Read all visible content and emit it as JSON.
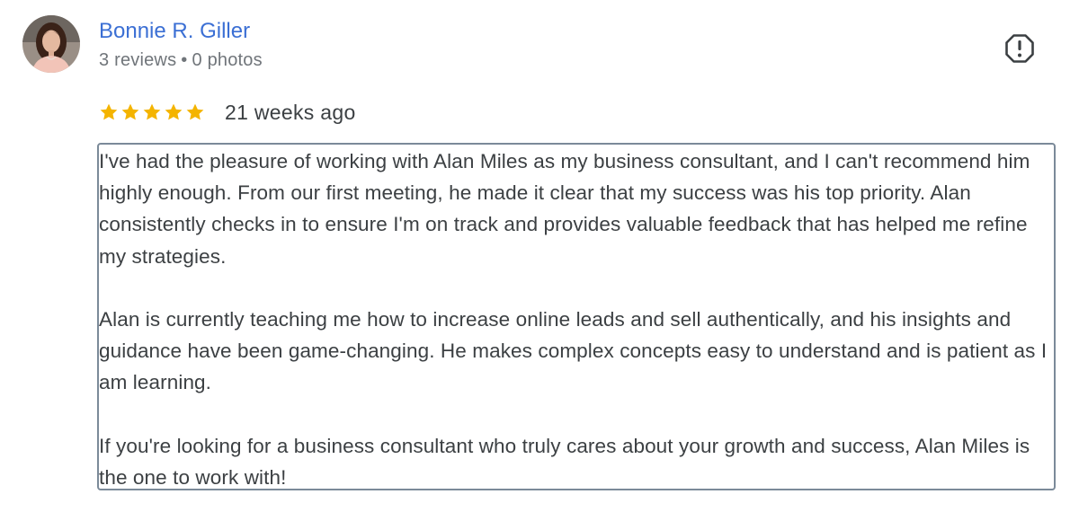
{
  "author": {
    "name": "Bonnie R. Giller",
    "reviews": "3 reviews",
    "separator": "•",
    "photos": "0 photos",
    "avatar_icon": "profile-photo"
  },
  "rating": {
    "stars": 5,
    "max_stars": 5,
    "time_ago": "21 weeks ago",
    "star_color": "#f4b400"
  },
  "actions": {
    "flag_icon": "report-flag-icon"
  },
  "review": {
    "paragraphs": [
      "I've had the pleasure of working with Alan Miles as my business consultant, and I can't recommend him highly enough. From our first meeting, he made it clear that my success was his top priority. Alan consistently checks in to ensure I'm on track and provides valuable feedback that has helped me refine my strategies.",
      "Alan is currently teaching me how to increase online leads and sell authentically, and his insights and guidance have been game-changing. He makes complex concepts easy to understand and is patient as I am learning.",
      "If you're looking for a business consultant who truly cares about your growth and success, Alan Miles is the one to work with!"
    ]
  },
  "colors": {
    "name_link": "#3b6fd4",
    "meta_text": "#70757a",
    "body_text": "#3c4043",
    "box_border": "#7b8a99"
  }
}
